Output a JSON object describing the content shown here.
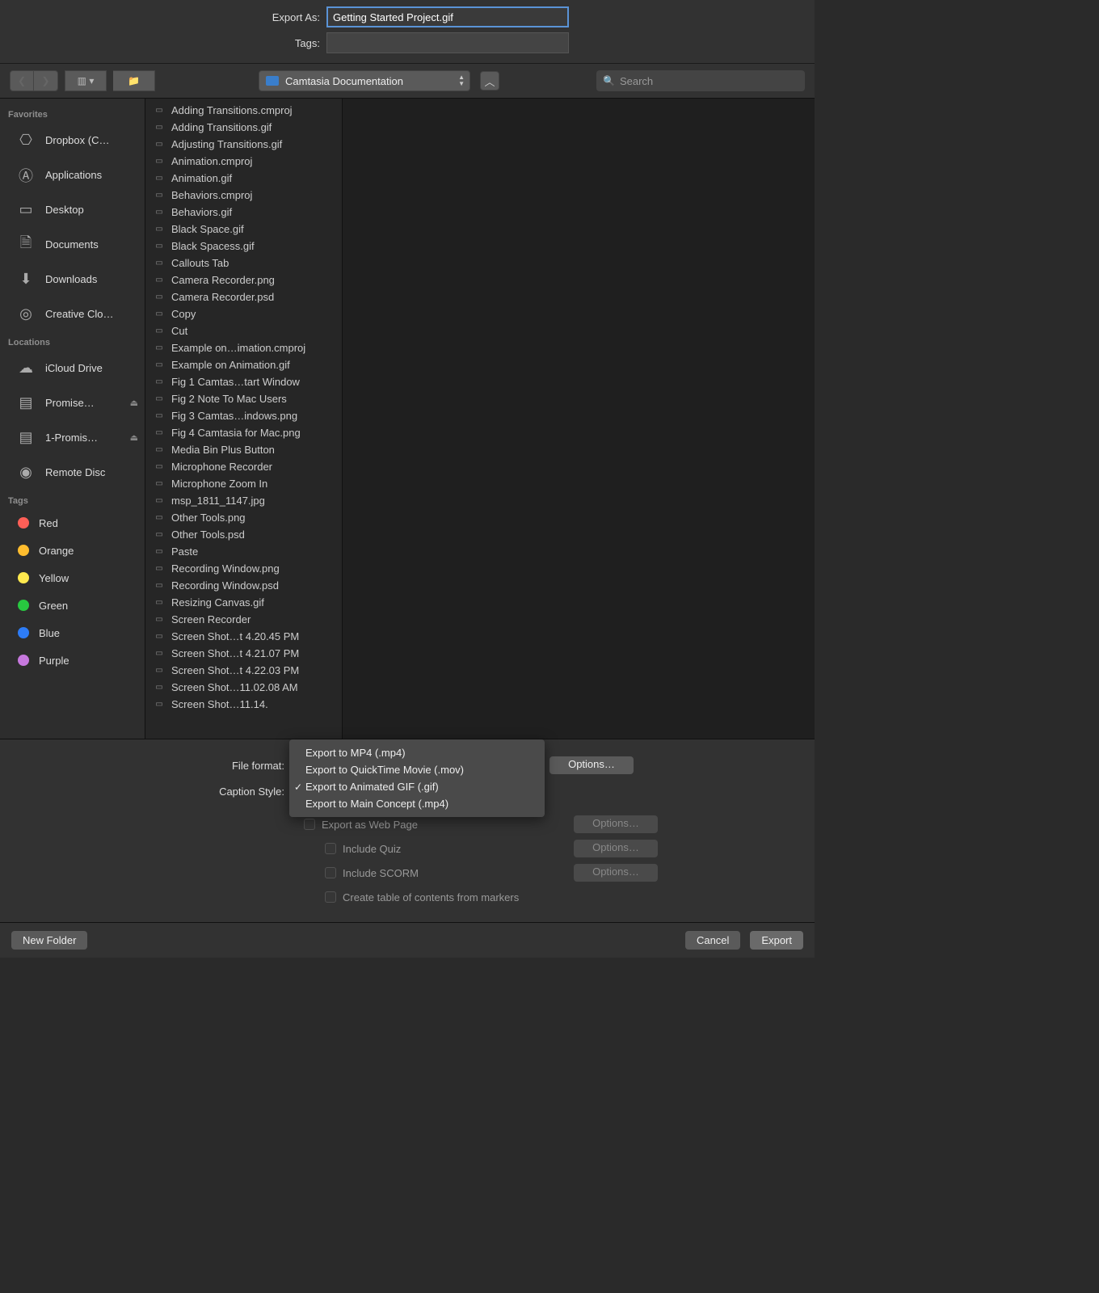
{
  "header": {
    "export_as_label": "Export As:",
    "export_as_value": "Getting Started Project.gif",
    "tags_label": "Tags:",
    "tags_value": ""
  },
  "toolbar": {
    "path_location": "Camtasia Documentation",
    "search_placeholder": "Search"
  },
  "sidebar": {
    "sections": [
      {
        "title": "Favorites",
        "items": [
          {
            "icon": "dropbox",
            "label": "Dropbox (C…"
          },
          {
            "icon": "apps",
            "label": "Applications"
          },
          {
            "icon": "desktop",
            "label": "Desktop"
          },
          {
            "icon": "docs",
            "label": "Documents"
          },
          {
            "icon": "down",
            "label": "Downloads"
          },
          {
            "icon": "cc",
            "label": "Creative Clo…"
          }
        ]
      },
      {
        "title": "Locations",
        "items": [
          {
            "icon": "cloud",
            "label": "iCloud Drive"
          },
          {
            "icon": "hdd",
            "label": "Promise…",
            "eject": true
          },
          {
            "icon": "hdd",
            "label": "1-Promis…",
            "eject": true
          },
          {
            "icon": "disc",
            "label": "Remote Disc"
          }
        ]
      },
      {
        "title": "Tags",
        "tags": [
          {
            "color": "#ff5f57",
            "label": "Red"
          },
          {
            "color": "#ffbd2e",
            "label": "Orange"
          },
          {
            "color": "#ffe94e",
            "label": "Yellow"
          },
          {
            "color": "#28c840",
            "label": "Green"
          },
          {
            "color": "#2d7cf6",
            "label": "Blue"
          },
          {
            "color": "#c678dd",
            "label": "Purple"
          }
        ]
      }
    ]
  },
  "files": [
    "Adding Transitions.cmproj",
    "Adding Transitions.gif",
    "Adjusting Transitions.gif",
    "Animation.cmproj",
    "Animation.gif",
    "Behaviors.cmproj",
    "Behaviors.gif",
    "Black Space.gif",
    "Black Spacess.gif",
    "Callouts Tab",
    "Camera Recorder.png",
    "Camera Recorder.psd",
    "Copy",
    "Cut",
    "Example on…imation.cmproj",
    "Example on Animation.gif",
    "Fig 1 Camtas…tart Window",
    "Fig 2 Note To Mac Users",
    "Fig 3 Camtas…indows.png",
    "Fig 4 Camtasia for Mac.png",
    "Media Bin Plus Button",
    "Microphone Recorder",
    "Microphone Zoom In",
    "msp_1811_1147.jpg",
    "Other Tools.png",
    "Other Tools.psd",
    "Paste",
    "Recording Window.png",
    "Recording Window.psd",
    "Resizing Canvas.gif",
    "Screen Recorder",
    "Screen Shot…t 4.20.45 PM",
    "Screen Shot…t 4.21.07 PM",
    "Screen Shot…t 4.22.03 PM",
    "Screen Shot…11.02.08 AM",
    "Screen Shot…11.14."
  ],
  "options": {
    "file_format_label": "File format:",
    "caption_style_label": "Caption Style:",
    "format_menu": [
      {
        "label": "Export to MP4 (.mp4)",
        "checked": false
      },
      {
        "label": "Export to QuickTime Movie (.mov)",
        "checked": false
      },
      {
        "label": "Export to Animated GIF (.gif)",
        "checked": true
      },
      {
        "label": "Export to Main Concept (.mp4)",
        "checked": false
      }
    ],
    "options_btn": "Options…",
    "checkboxes": {
      "web": "Export as Web Page",
      "quiz": "Include Quiz",
      "scorm": "Include SCORM",
      "toc": "Create table of contents from markers"
    }
  },
  "footer": {
    "new_folder": "New Folder",
    "cancel": "Cancel",
    "export": "Export"
  }
}
